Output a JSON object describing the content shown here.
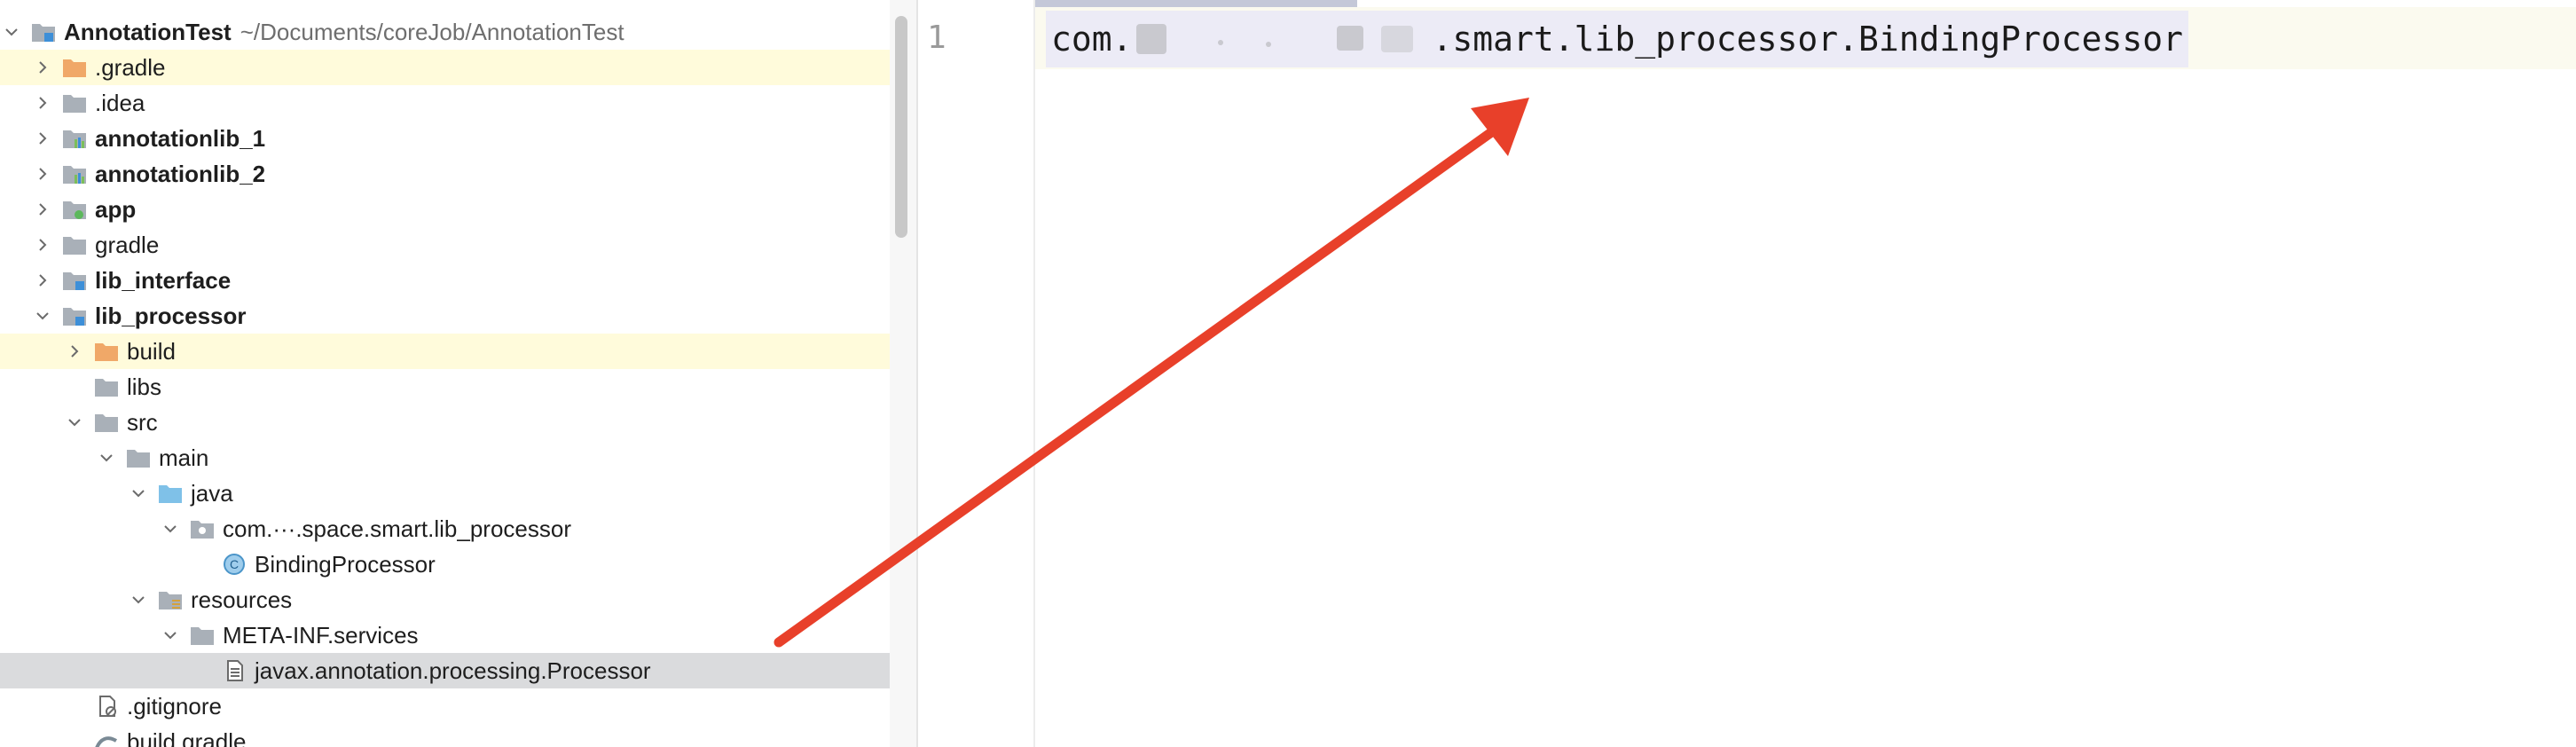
{
  "project": {
    "name": "AnnotationTest",
    "path": "~/Documents/coreJob/AnnotationTest"
  },
  "tree": [
    {
      "label": ".gradle"
    },
    {
      "label": ".idea"
    },
    {
      "label": "annotationlib_1"
    },
    {
      "label": "annotationlib_2"
    },
    {
      "label": "app"
    },
    {
      "label": "gradle"
    },
    {
      "label": "lib_interface"
    },
    {
      "label": "lib_processor"
    },
    {
      "label": "build"
    },
    {
      "label": "libs"
    },
    {
      "label": "src"
    },
    {
      "label": "main"
    },
    {
      "label": "java"
    },
    {
      "label": "com.···.space.smart.lib_processor"
    },
    {
      "label": "BindingProcessor"
    },
    {
      "label": "resources"
    },
    {
      "label": "META-INF.services"
    },
    {
      "label": "javax.annotation.processing.Processor"
    },
    {
      "label": ".gitignore"
    },
    {
      "label": "build.gradle"
    }
  ],
  "editor": {
    "line_number": "1",
    "code_prefix": "com.",
    "code_suffix": ".smart.lib_processor.BindingProcessor"
  },
  "colors": {
    "arrow": "#e8402a",
    "folder": "#a9b0b8",
    "folder_excluded": "#f0a868",
    "source_folder": "#7fc1e8",
    "selection": "#dadbdd",
    "highlight": "#fffbdb"
  }
}
